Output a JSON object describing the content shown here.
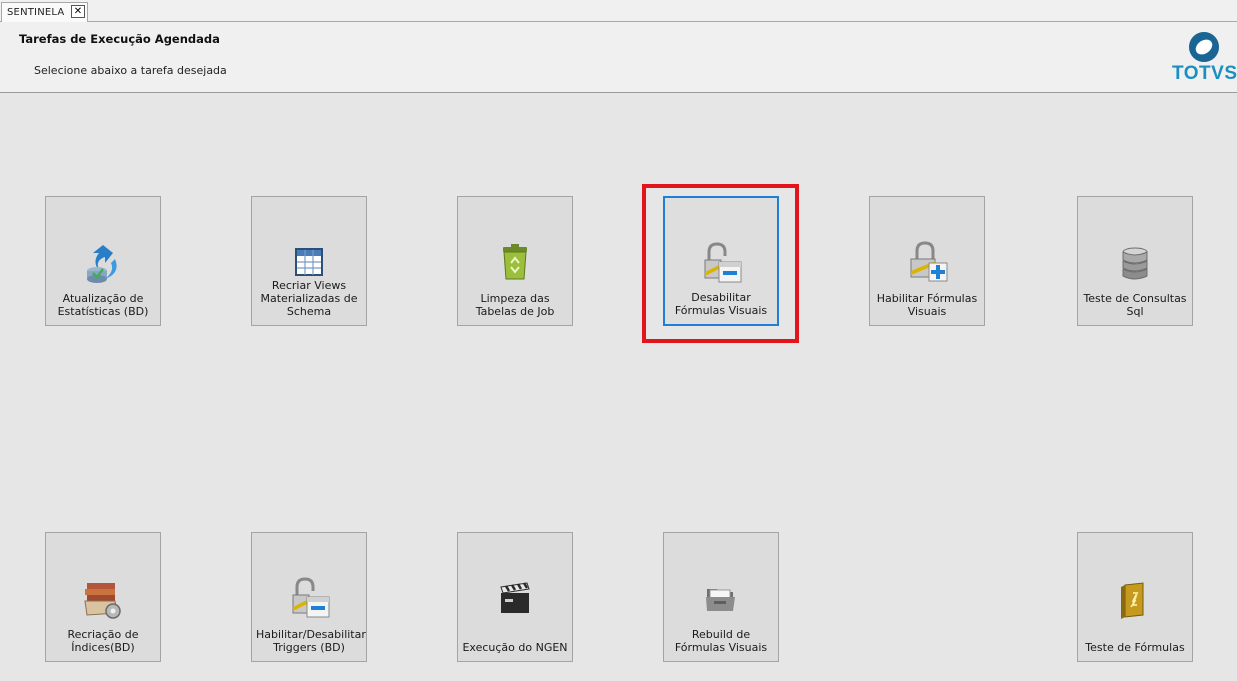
{
  "tab": {
    "label": "SENTINELA",
    "close_symbol": "✕"
  },
  "header": {
    "title": "Tarefas de Execução Agendada",
    "subtitle": "Selecione abaixo a tarefa desejada",
    "logo_text": "TOTVS"
  },
  "tiles": [
    {
      "label": "Atualização de Estatísticas (BD)",
      "icon": "refresh-database-icon"
    },
    {
      "label": "Recriar Views Materializadas de Schema",
      "icon": "table-grid-icon"
    },
    {
      "label": "Limpeza das Tabelas de Job",
      "icon": "recycle-bin-icon"
    },
    {
      "label": "Desabilitar Fórmulas Visuais",
      "icon": "lock-minus-icon",
      "selected": true
    },
    {
      "label": "Habilitar Fórmulas Visuais",
      "icon": "lock-plus-icon"
    },
    {
      "label": "Teste de Consultas Sql",
      "icon": "database-stack-icon"
    },
    {
      "label": "Recriação de Índices(BD)",
      "icon": "books-gear-icon"
    },
    {
      "label": "Habilitar/Desabilitar Triggers (BD)",
      "icon": "lock-toggle-icon"
    },
    {
      "label": "Execução do NGEN",
      "icon": "clapperboard-icon"
    },
    {
      "label": "Rebuild de Fórmulas Visuais",
      "icon": "folder-open-icon"
    },
    {
      "label": "Teste de Fórmulas",
      "icon": "formula-book-icon"
    }
  ],
  "colors": {
    "selected_border": "#1e7fd6",
    "highlight_frame": "#e2141c",
    "logo_blue": "#1a8fc0"
  }
}
